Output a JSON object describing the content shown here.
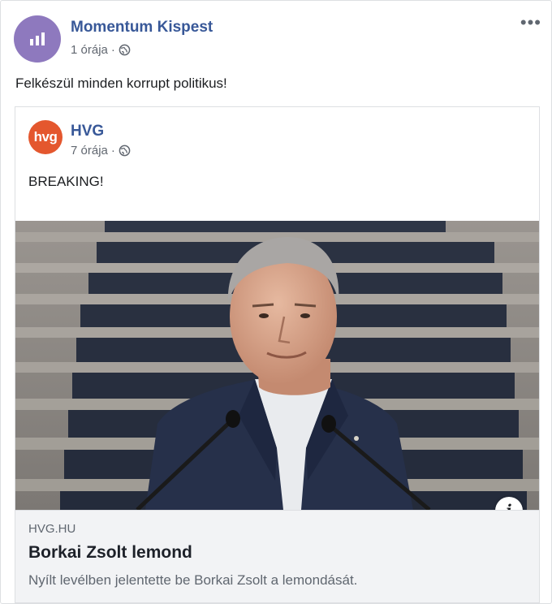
{
  "post": {
    "page_name": "Momentum Kispest",
    "time": "1 órája",
    "separator": "·",
    "text": "Felkészül minden korrupt politikus!",
    "more_label": "•••"
  },
  "shared_post": {
    "page_name": "HVG",
    "avatar_text": "hvg",
    "time": "7 órája",
    "separator": "·",
    "text": "BREAKING!",
    "info_label": "i"
  },
  "link": {
    "domain": "HVG.HU",
    "title": "Borkai Zsolt lemond",
    "description": "Nyílt levélben jelentette be Borkai Zsolt a lemondását."
  },
  "colors": {
    "brand_link": "#385898",
    "momentum_avatar": "#8e79be",
    "hvg_avatar": "#e4572e",
    "link_box_bg": "#f2f3f5"
  },
  "icons": [
    "momentum-logo-icon",
    "globe-icon",
    "more-options-icon",
    "info-icon"
  ]
}
